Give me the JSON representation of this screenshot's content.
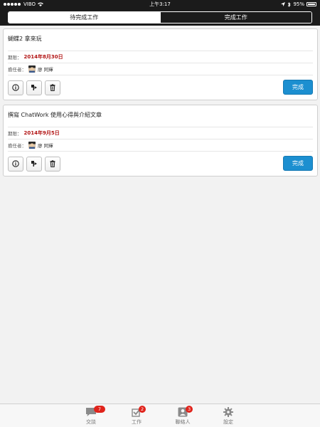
{
  "status_bar": {
    "carrier": "VIBO",
    "time": "上午3:17",
    "battery": "95%"
  },
  "segment": {
    "tab_pending": "待完成工作",
    "tab_completed": "完成工作"
  },
  "tasks": [
    {
      "title": "蝴蝶2 拿來玩",
      "deadline_label": "期限：",
      "deadline": "2014年8月30日",
      "assignee_label": "擔任者：",
      "assignee": "廖 阿輝",
      "done_label": "完成"
    },
    {
      "title": "撰寫 ChatWork  使用心得與介紹文章",
      "deadline_label": "期限：",
      "deadline": "2014年9月5日",
      "assignee_label": "擔任者：",
      "assignee": "廖 阿輝",
      "done_label": "完成"
    }
  ],
  "tabbar": {
    "chat": {
      "label": "交談",
      "badge": "7 (1)"
    },
    "tasks": {
      "label": "工作",
      "badge": "2"
    },
    "contacts": {
      "label": "聯絡人",
      "badge": "3"
    },
    "settings": {
      "label": "設定"
    }
  },
  "colors": {
    "accent_blue": "#1c8fd0",
    "deadline_red": "#b21414",
    "badge_red": "#e0231b",
    "header_dark": "#1b1b1b"
  }
}
